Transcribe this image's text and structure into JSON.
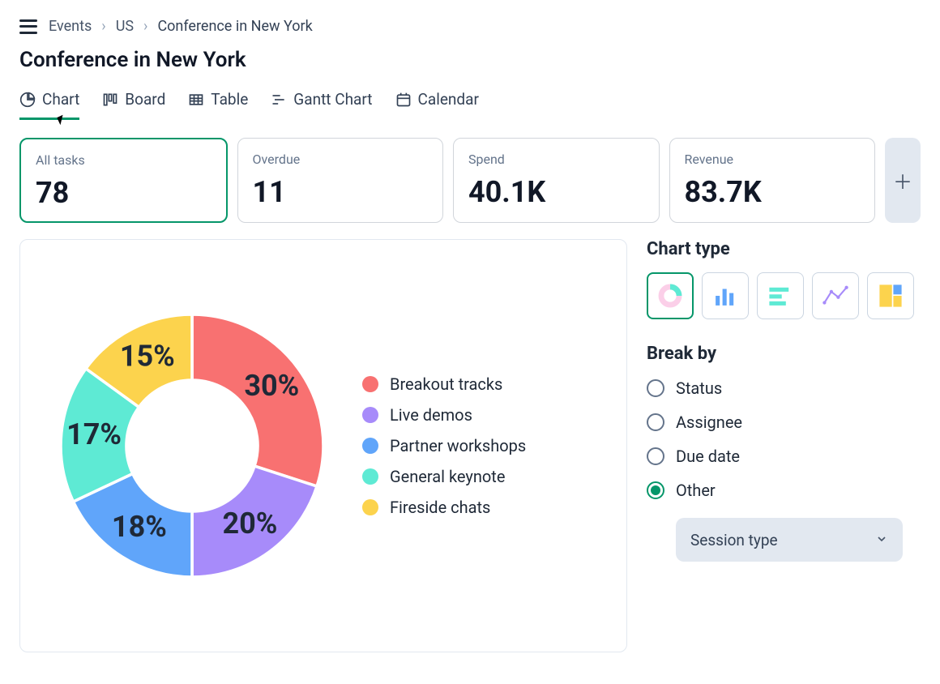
{
  "breadcrumb": {
    "items": [
      "Events",
      "US",
      "Conference in New York"
    ]
  },
  "page_title": "Conference in New York",
  "tabs": {
    "chart": "Chart",
    "board": "Board",
    "table": "Table",
    "gantt": "Gantt Chart",
    "calendar": "Calendar",
    "active": "chart"
  },
  "kpis": [
    {
      "label": "All tasks",
      "value": "78",
      "active": true
    },
    {
      "label": "Overdue",
      "value": "11",
      "active": false
    },
    {
      "label": "Spend",
      "value": "40.1K",
      "active": false
    },
    {
      "label": "Revenue",
      "value": "83.7K",
      "active": false
    }
  ],
  "chart_data": {
    "type": "pie",
    "title": "",
    "series": [
      {
        "name": "Breakout tracks",
        "value": 30,
        "color": "#f87171"
      },
      {
        "name": "Live demos",
        "value": 20,
        "color": "#a78bfa"
      },
      {
        "name": "Partner workshops",
        "value": 18,
        "color": "#60a5fa"
      },
      {
        "name": "General keynote",
        "value": 17,
        "color": "#5eead4"
      },
      {
        "name": "Fireside chats",
        "value": 15,
        "color": "#fcd34d"
      }
    ],
    "value_suffix": "%",
    "donut": true
  },
  "side": {
    "chart_type_title": "Chart type",
    "chart_types": [
      "donut",
      "bar-vertical",
      "bar-horizontal",
      "line",
      "treemap"
    ],
    "chart_type_active": "donut",
    "break_by_title": "Break by",
    "break_by_options": [
      {
        "key": "status",
        "label": "Status",
        "checked": false
      },
      {
        "key": "assignee",
        "label": "Assignee",
        "checked": false
      },
      {
        "key": "due_date",
        "label": "Due date",
        "checked": false
      },
      {
        "key": "other",
        "label": "Other",
        "checked": true
      }
    ],
    "other_select": "Session type"
  }
}
